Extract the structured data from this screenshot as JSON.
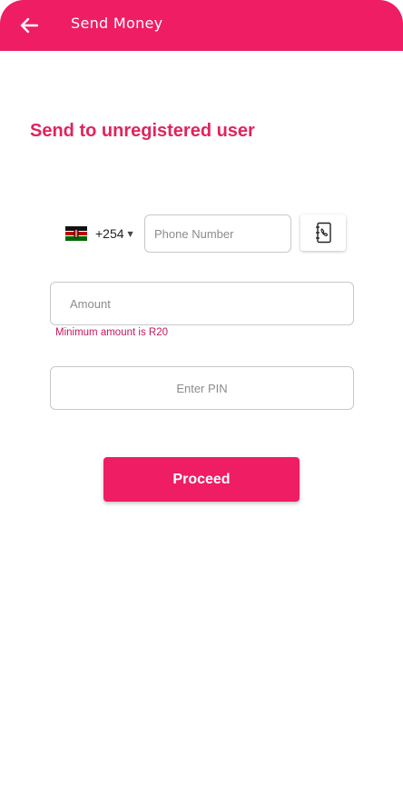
{
  "app_bar": {
    "title": "Send Money",
    "back_icon": "arrow-left-icon",
    "background": "#ef1d63"
  },
  "section": {
    "title": "Send to unregistered user"
  },
  "phone": {
    "country_flag": "kenya-flag-icon",
    "country_code": "+254",
    "placeholder": "Phone Number",
    "value": "",
    "contacts_icon": "contact-book-icon"
  },
  "amount": {
    "placeholder": "Amount",
    "value": "",
    "helper": "Minimum amount is R20"
  },
  "pin": {
    "placeholder": "Enter PIN",
    "value": ""
  },
  "actions": {
    "proceed_label": "Proceed"
  },
  "colors": {
    "primary": "#ef1d63",
    "title_text": "#e0245e",
    "helper_text": "#c2185b"
  }
}
